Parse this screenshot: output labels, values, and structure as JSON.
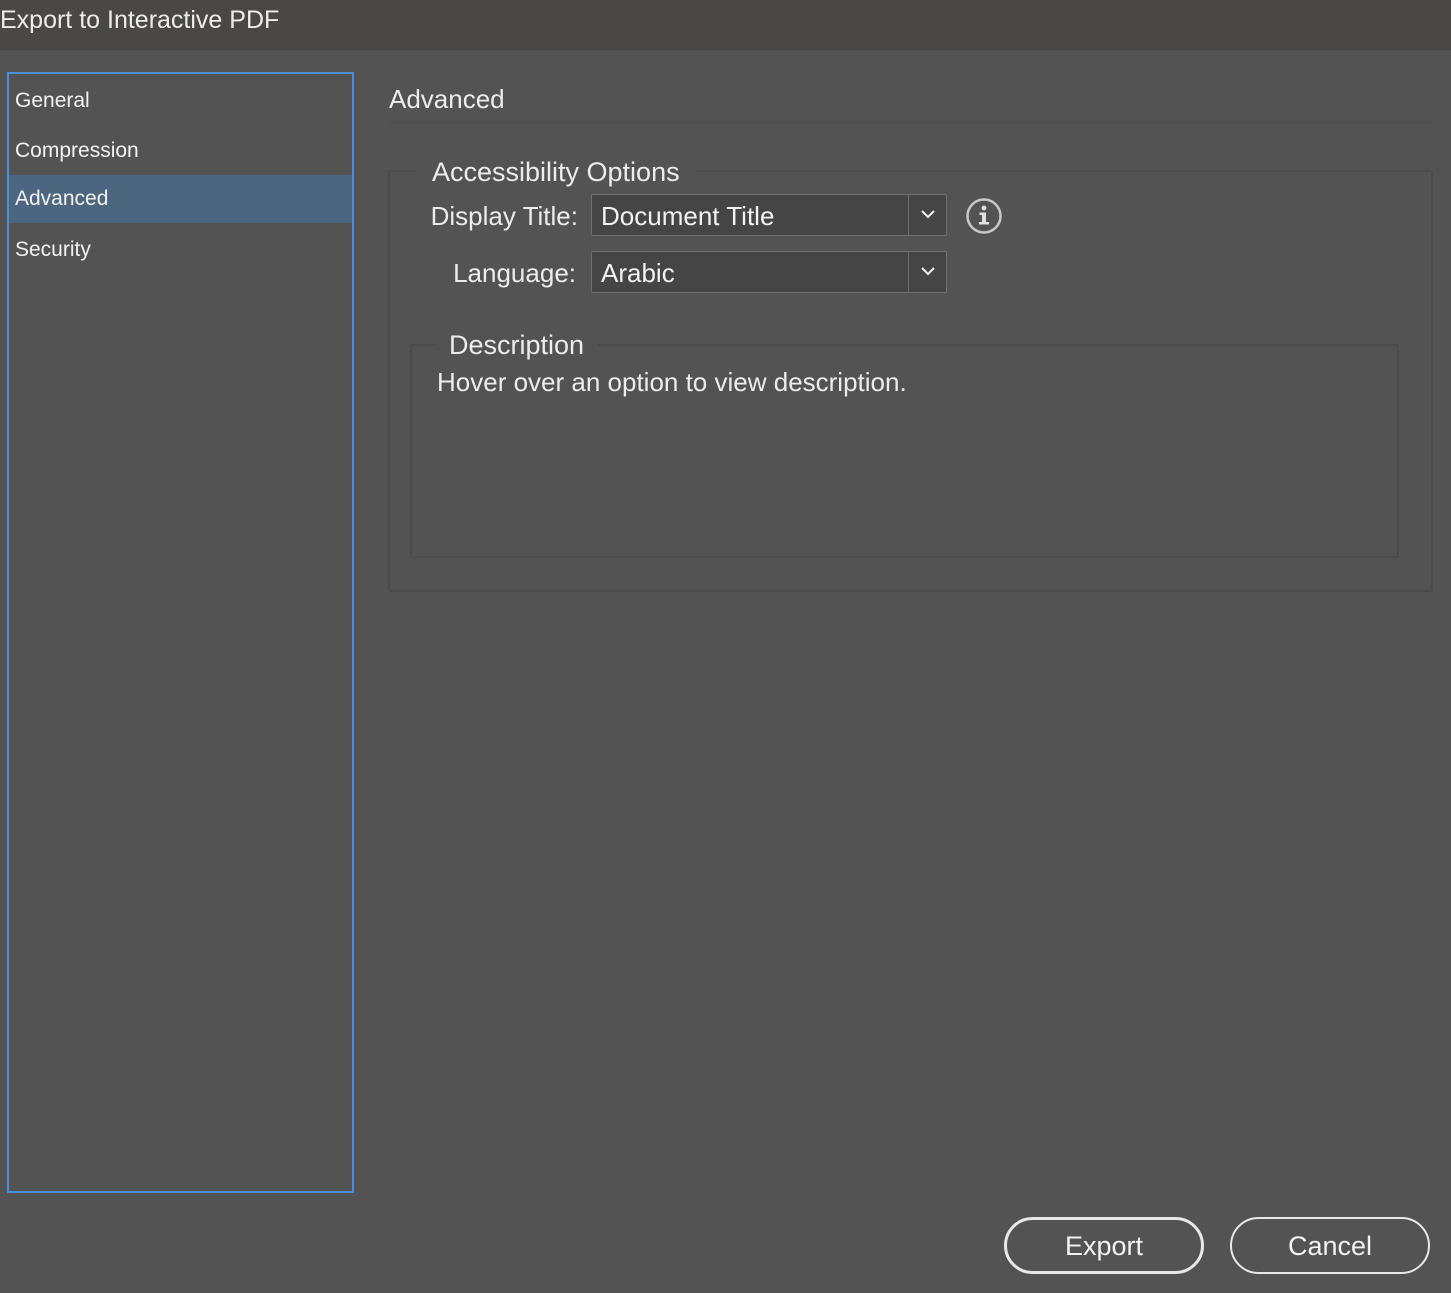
{
  "window": {
    "title": "Export to Interactive PDF"
  },
  "sidebar": {
    "items": [
      {
        "label": "General",
        "selected": false
      },
      {
        "label": "Compression",
        "selected": false
      },
      {
        "label": "Advanced",
        "selected": true
      },
      {
        "label": "Security",
        "selected": false
      }
    ]
  },
  "main": {
    "section_title": "Advanced",
    "accessibility": {
      "legend": "Accessibility Options",
      "display_title": {
        "label": "Display Title:",
        "value": "Document Title"
      },
      "language": {
        "label": "Language:",
        "value": "Arabic"
      },
      "info_icon": "info-circle-icon"
    },
    "description": {
      "legend": "Description",
      "text": "Hover over an option to view description."
    }
  },
  "buttons": {
    "export_label": "Export",
    "cancel_label": "Cancel"
  },
  "colors": {
    "background": "#535353",
    "titlebar": "#4a4847",
    "selection": "#4d667f",
    "focus_border": "#4a90d9",
    "text": "#f0f0f0"
  }
}
